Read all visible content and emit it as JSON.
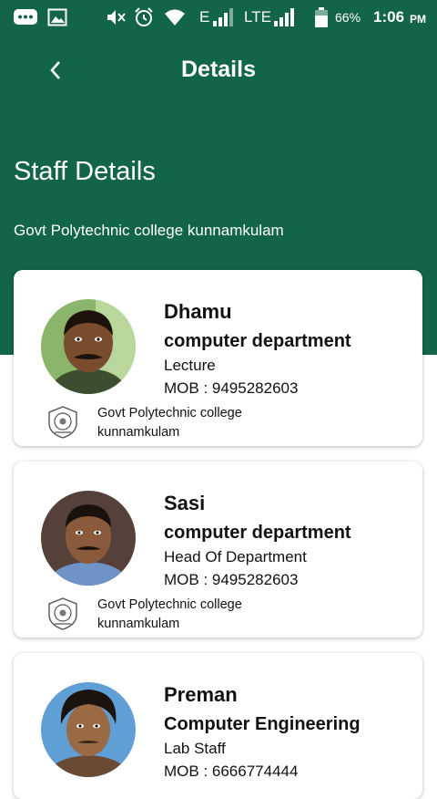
{
  "status_bar": {
    "time": "1:06",
    "ampm": "PM",
    "battery": "66%",
    "network_e": "E",
    "network_lte": "LTE"
  },
  "app_bar": {
    "title": "Details"
  },
  "header": {
    "title": "Staff Details",
    "subtitle": "Govt Polytechnic college kunnamkulam"
  },
  "staff": [
    {
      "name": "Dhamu",
      "department": "computer department",
      "role": "Lecture",
      "mobile": "MOB : 9495282603",
      "college": "Govt Polytechnic college kunnamkulam"
    },
    {
      "name": "Sasi",
      "department": "computer department",
      "role": "Head Of Department",
      "mobile": "MOB : 9495282603",
      "college": "Govt Polytechnic college kunnamkulam"
    },
    {
      "name": "Preman",
      "department": "Computer Engineering",
      "role": "Lab Staff",
      "mobile": "MOB : 6666774444",
      "college": ""
    }
  ],
  "colors": {
    "primary": "#136547",
    "card": "#ffffff",
    "text": "#111111"
  }
}
